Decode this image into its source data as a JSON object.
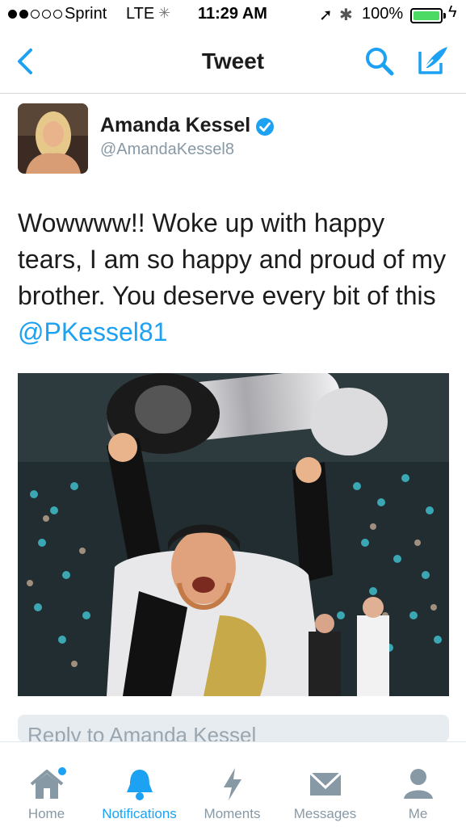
{
  "status_bar": {
    "carrier": "Sprint",
    "network": "LTE",
    "time": "11:29 AM",
    "battery_percent": "100%",
    "signal_bars": 2,
    "signal_total": 5,
    "battery_level": 1.0
  },
  "nav": {
    "title": "Tweet",
    "back_icon": "chevron-left-icon",
    "search_icon": "search-icon",
    "compose_icon": "compose-icon"
  },
  "tweet": {
    "author_name": "Amanda Kessel",
    "author_handle": "@AmandaKessel8",
    "verified": true,
    "text": "Wowwww!! Woke up with happy tears, I am so happy and proud of my brother. You deserve every bit of this ",
    "mention": "@PKessel81"
  },
  "reply": {
    "placeholder": "Reply to Amanda Kessel"
  },
  "tabs": [
    {
      "label": "Home",
      "icon": "home-icon",
      "active": false,
      "badge": true
    },
    {
      "label": "Notifications",
      "icon": "bell-icon",
      "active": true
    },
    {
      "label": "Moments",
      "icon": "lightning-icon",
      "active": false
    },
    {
      "label": "Messages",
      "icon": "envelope-icon",
      "active": false
    },
    {
      "label": "Me",
      "icon": "person-icon",
      "active": false
    }
  ],
  "colors": {
    "accent": "#1da1f2",
    "inactive": "#8899a6",
    "battery": "#4cd964"
  }
}
